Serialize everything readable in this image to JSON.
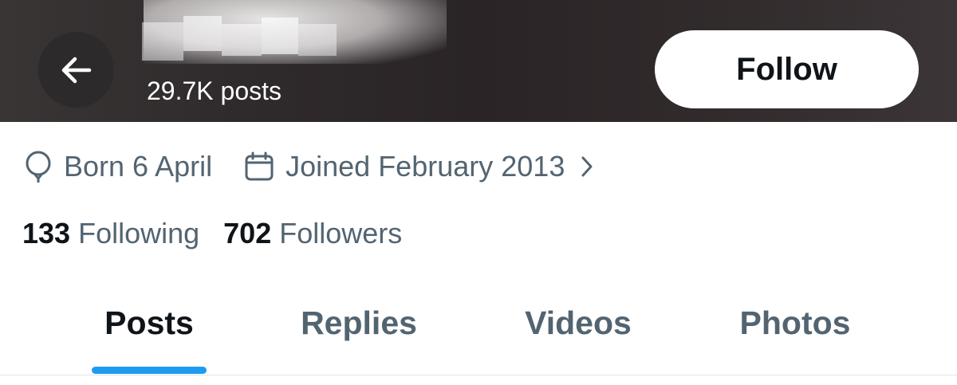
{
  "header": {
    "post_count": "29.7K posts",
    "back_icon": "arrow-left-icon",
    "follow_label": "Follow"
  },
  "profile_info": {
    "birthday": {
      "icon": "balloon-icon",
      "text": "Born 6 April"
    },
    "joined": {
      "icon": "calendar-icon",
      "text": "Joined February 2013",
      "chevron_icon": "chevron-right-icon"
    }
  },
  "stats": {
    "following": {
      "count": "133",
      "label": "Following"
    },
    "followers": {
      "count": "702",
      "label": "Followers"
    }
  },
  "tabs": [
    {
      "label": "Posts",
      "active": true
    },
    {
      "label": "Replies",
      "active": false
    },
    {
      "label": "Videos",
      "active": false
    },
    {
      "label": "Photos",
      "active": false
    }
  ],
  "colors": {
    "accent": "#1d9bf0",
    "text_primary": "#0f1419",
    "text_secondary": "#536471"
  }
}
